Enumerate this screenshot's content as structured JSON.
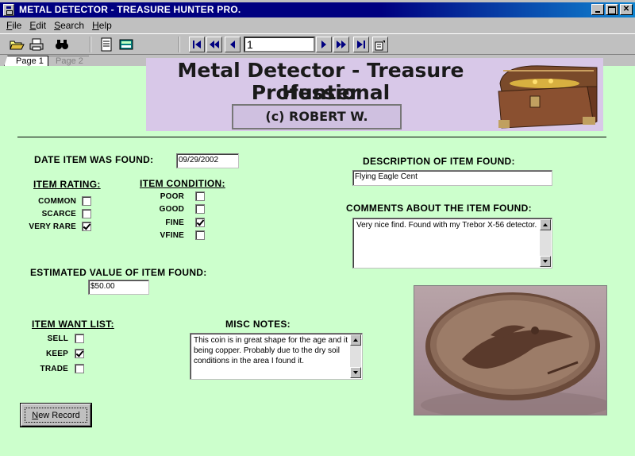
{
  "window": {
    "title": "METAL DETECTOR - TREASURE HUNTER PRO."
  },
  "menu": [
    {
      "label": "File",
      "accel": "F",
      "rest": "ile"
    },
    {
      "label": "Edit",
      "accel": "E",
      "rest": "dit"
    },
    {
      "label": "Search",
      "accel": "S",
      "rest": "earch"
    },
    {
      "label": "Help",
      "accel": "H",
      "rest": "elp"
    }
  ],
  "toolbar": {
    "record_number": "1",
    "icons": [
      "open-folder-icon",
      "print-icon",
      "find-binoculars-icon",
      "report-icon",
      "calculator-icon"
    ]
  },
  "tabs": {
    "page1": "Page 1",
    "page2": "Page 2"
  },
  "banner": {
    "line1": "Metal Detector - Treasure Hunter",
    "line2": "Professional",
    "copyright": "(c) ROBERT W. BENJAMIN"
  },
  "form": {
    "date_label": "DATE ITEM WAS FOUND:",
    "date_value": "09/29/2002",
    "rating_label": "ITEM RATING:",
    "rating": [
      {
        "label": "COMMON",
        "checked": false
      },
      {
        "label": "SCARCE",
        "checked": false
      },
      {
        "label": "VERY RARE",
        "checked": true
      }
    ],
    "condition_label": "ITEM CONDITION:",
    "condition": [
      {
        "label": "POOR",
        "checked": false
      },
      {
        "label": "GOOD",
        "checked": false
      },
      {
        "label": "FINE",
        "checked": true
      },
      {
        "label": "VFINE",
        "checked": false
      }
    ],
    "value_label": "ESTIMATED VALUE OF ITEM FOUND:",
    "value_amount": "$50.00",
    "want_label": "ITEM WANT LIST:",
    "want": [
      {
        "label": "SELL",
        "checked": false
      },
      {
        "label": "KEEP",
        "checked": true
      },
      {
        "label": "TRADE",
        "checked": false
      }
    ],
    "misc_label": "MISC NOTES:",
    "misc_text": "This coin is in great shape for the age and it being copper. Probably due to the dry soil conditions in the area I found it.",
    "description_label": "DESCRIPTION OF ITEM FOUND:",
    "description_value": "Flying Eagle Cent",
    "comments_label": "COMMENTS ABOUT THE ITEM FOUND:",
    "comments_text": "Very nice find. Found with my Trebor X-56 detector.",
    "new_record": {
      "label": "New Record",
      "accel": "N",
      "rest": "ew Record"
    }
  },
  "colors": {
    "title_bar": "#000080",
    "form_bg": "#ccffcc",
    "banner_bg": "#d8c8e8"
  }
}
